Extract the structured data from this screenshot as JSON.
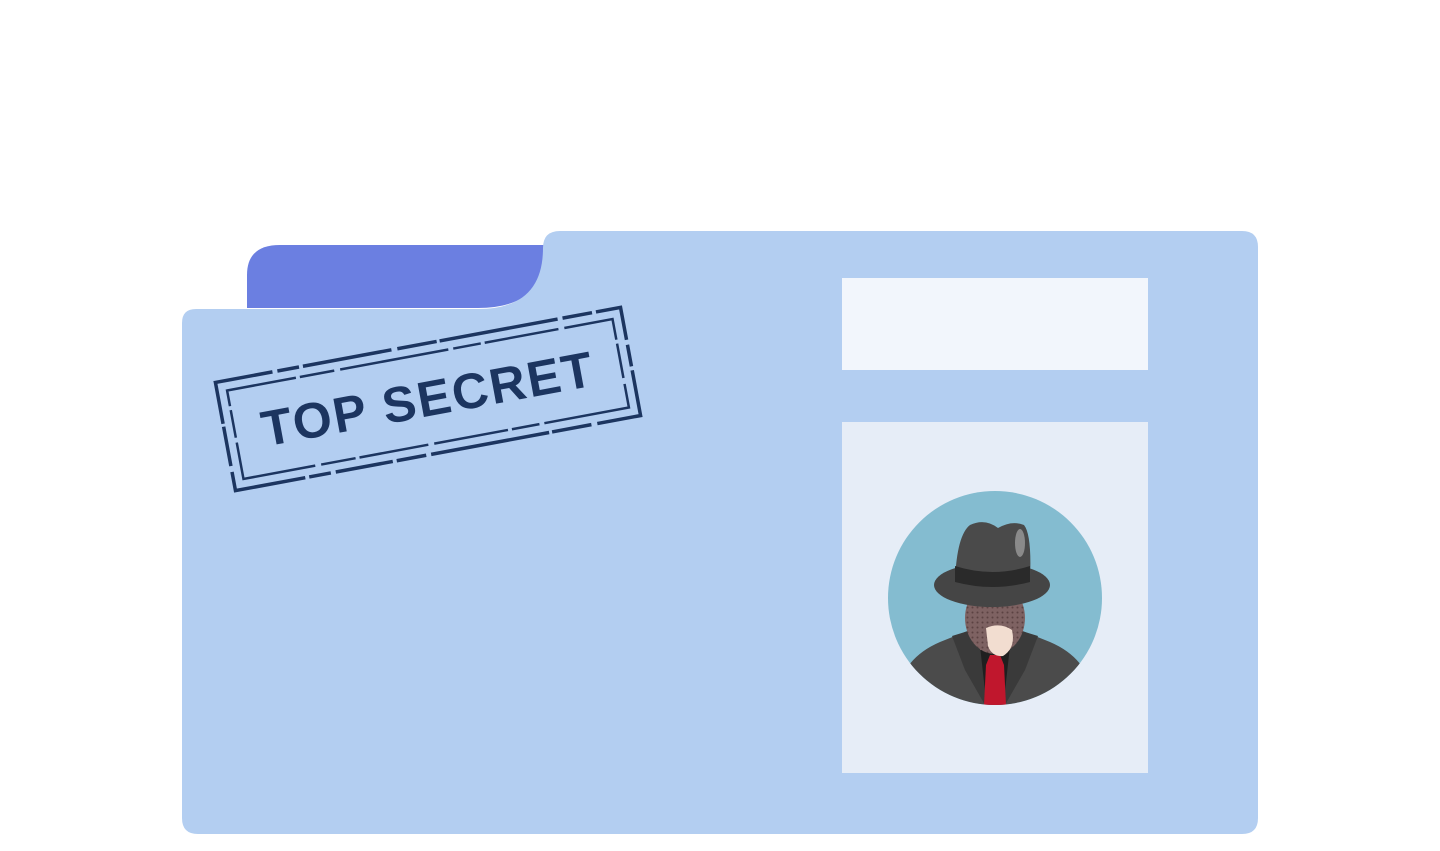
{
  "stamp": {
    "text": "TOP SECRET"
  },
  "colors": {
    "background": "#ffffff",
    "folder": "#b3cef1",
    "folder_tab": "#6b7fe1",
    "stamp_ink": "#1c3560",
    "label_card": "#f2f6fc",
    "photo_card": "#e6edf7",
    "avatar_bg": "#84bcd0",
    "hat": "#454545",
    "hat_band": "#2a2a2a",
    "coat": "#4b4b4b",
    "coat_shadow": "#3a3a3a",
    "face": "#8a6d6d",
    "chin": "#f2ddd0",
    "shirt": "#1f1f1f",
    "tie": "#c0172d"
  },
  "icons": {
    "avatar": "spy-avatar-icon",
    "stamp": "top-secret-stamp"
  }
}
